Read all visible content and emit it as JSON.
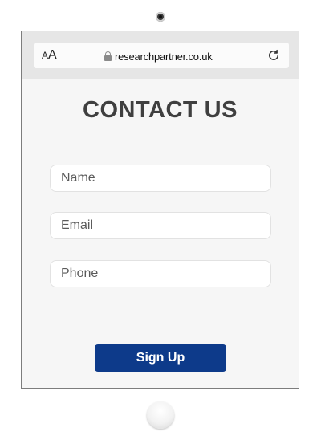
{
  "browser": {
    "text_size_small": "A",
    "text_size_large": "A",
    "url": "researchpartner.co.uk",
    "lock_icon": "lock-icon",
    "reload_icon": "reload-icon"
  },
  "page": {
    "title": "CONTACT US"
  },
  "form": {
    "name_placeholder": "Name",
    "email_placeholder": "Email",
    "phone_placeholder": "Phone",
    "submit_label": "Sign Up"
  },
  "colors": {
    "button_bg": "#0d3a8a",
    "title_text": "#3f3f3f",
    "page_bg": "#f6f6f6",
    "browser_bar_bg": "#e6e6e6"
  }
}
